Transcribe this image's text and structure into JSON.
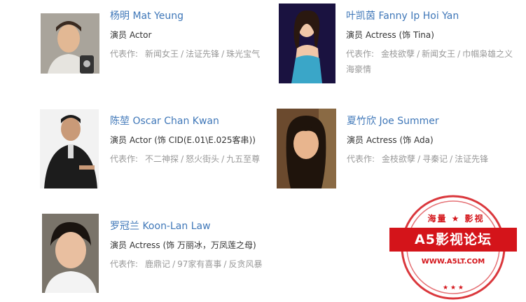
{
  "cast": [
    {
      "name": "杨明 Mat Yeung",
      "role": "演员 Actor",
      "works_label": "代表作:",
      "works": [
        "新闻女王",
        "法证先锋",
        "珠光宝气"
      ],
      "photo": "portrait-man-phone"
    },
    {
      "name": "叶凯茵 Fanny Ip Hoi Yan",
      "role": "演员 Actress (饰 Tina)",
      "works_label": "代表作:",
      "works": [
        "金枝欲孽",
        "新闻女王",
        "巾帼枭雄之义海豪情"
      ],
      "photo": "portrait-woman-blue-dress"
    },
    {
      "name": "陈堃 Oscar Chan Kwan",
      "role": "演员 Actor (饰 CID(E.01\\E.025客串))",
      "works_label": "代表作:",
      "works": [
        "不二神探",
        "怒火街头",
        "九五至尊"
      ],
      "photo": "portrait-man-black-jacket"
    },
    {
      "name": "夏竹欣 Joe Summer",
      "role": "演员 Actress (饰 Ada)",
      "works_label": "代表作:",
      "works": [
        "金枝欲孽",
        "寻秦记",
        "法证先锋"
      ],
      "photo": "portrait-woman-dark-hair"
    },
    {
      "name": "罗冠兰 Koon-Lan Law",
      "role": "演员 Actress (饰 万丽冰，万凤莲之母)",
      "works_label": "代表作:",
      "works": [
        "鹿鼎记",
        "97家有喜事",
        "反贪风暴"
      ],
      "photo": "portrait-woman-short-hair"
    }
  ],
  "watermark": {
    "top_text": "海量 ★ 影视",
    "main_text": "A5影视论坛",
    "url": "WWW.A5LT.COM"
  },
  "colors": {
    "name_link": "#3f77b8",
    "role_text": "#333333",
    "works_text": "#999999",
    "stamp_red": "#d4141a"
  }
}
